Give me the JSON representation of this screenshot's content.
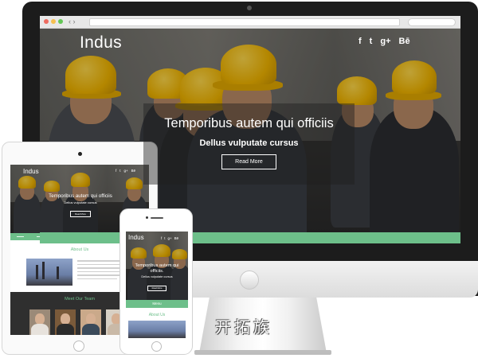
{
  "desktop": {
    "brand": "Indus",
    "social": [
      "f",
      "t",
      "g+",
      "Bē"
    ],
    "slide_title": "Temporibus autem qui officiis",
    "slide_subtitle": "Dellus vulputate cursus",
    "button_label": "Read More"
  },
  "tablet": {
    "brand": "Indus",
    "slide_title": "Temporibus autem qui officiis",
    "slide_subtitle": "Dellus vulputate cursus",
    "button_label": "Read More",
    "about_heading": "About Us",
    "team_heading": "Meet Our Team"
  },
  "phone": {
    "brand": "Indus",
    "slide_title": "Temporibus autem qui officiis.",
    "slide_subtitle": "Dellus vulputate cursus",
    "button_label": "Read More",
    "menu_label": "Menu",
    "about_heading": "About Us"
  },
  "watermark": "开拓族",
  "colors": {
    "accent_green": "#6dbf8a",
    "helmet_yellow": "#f0b400",
    "frame_dark": "#1c1c1c"
  }
}
